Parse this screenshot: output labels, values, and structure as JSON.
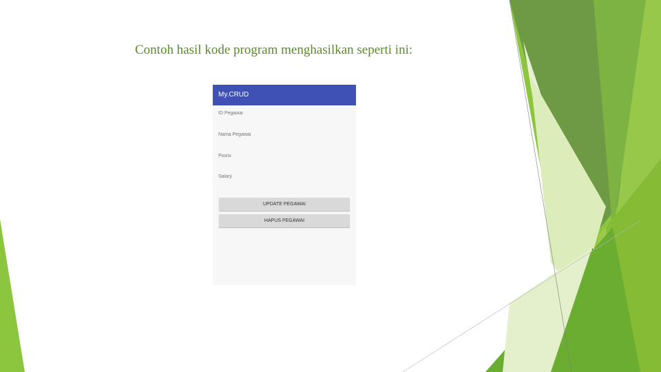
{
  "slide": {
    "title": "Contoh hasil kode program menghasilkan seperti ini:"
  },
  "app": {
    "title": "My.CRUD",
    "fields": [
      {
        "placeholder": "ID Pegawai"
      },
      {
        "placeholder": "Nama Pegawai"
      },
      {
        "placeholder": "Posisi"
      },
      {
        "placeholder": "Salary"
      }
    ],
    "buttons": {
      "update_label": "UPDATE PEGAWAI",
      "delete_label": "HAPUS PEGAWAI"
    }
  },
  "colors": {
    "appbar": "#3f51b5",
    "title_text": "#5a8a2a",
    "accent_dark": "#4e8a1e",
    "accent_light": "#9acd3c",
    "accent_pale": "#d8eab0"
  }
}
